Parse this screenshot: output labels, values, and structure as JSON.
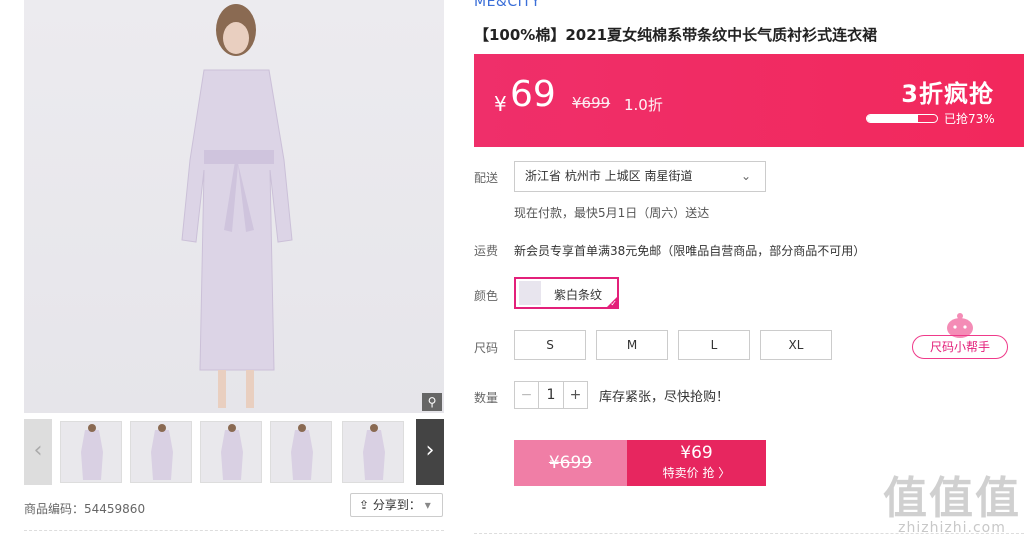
{
  "brand": "ME&CITY",
  "product": {
    "title": "【100%棉】2021夏女纯棉系带条纹中长气质衬衫式连衣裙",
    "sku_code": "商品编码：54459860",
    "share_label": "分享到：",
    "zoom_icon": "magnifier-icon"
  },
  "price_bar": {
    "currency": "¥",
    "price": "69",
    "original": "¥699",
    "discount": "1.0折",
    "promo": "3折疯抢",
    "sold_text": "已抢73%",
    "sold_fraction": 0.73,
    "bg_color": "#f2285c"
  },
  "delivery": {
    "label": "配送",
    "address": "浙江省 杭州市 上城区 南星街道",
    "eta": "现在付款，最快5月1日（周六）送达"
  },
  "shipping": {
    "label": "运费",
    "text": "新会员专享首单满38元免邮（限唯品自营商品，部分商品不可用）"
  },
  "color": {
    "label": "颜色",
    "selected": "紫白条纹",
    "accent": "#e3207a"
  },
  "size": {
    "label": "尺码",
    "options": [
      "S",
      "M",
      "L",
      "XL"
    ],
    "helper": "尺码小帮手"
  },
  "quantity": {
    "label": "数量",
    "minus": "−",
    "value": "1",
    "plus": "+",
    "stock_note": "库存紧张，尽快抢购！"
  },
  "buy": {
    "original": "¥699",
    "price": "¥69",
    "cta": "特卖价 抢 〉"
  },
  "watermark": {
    "big": "值值值",
    "small": "zhizhizhi.com"
  }
}
